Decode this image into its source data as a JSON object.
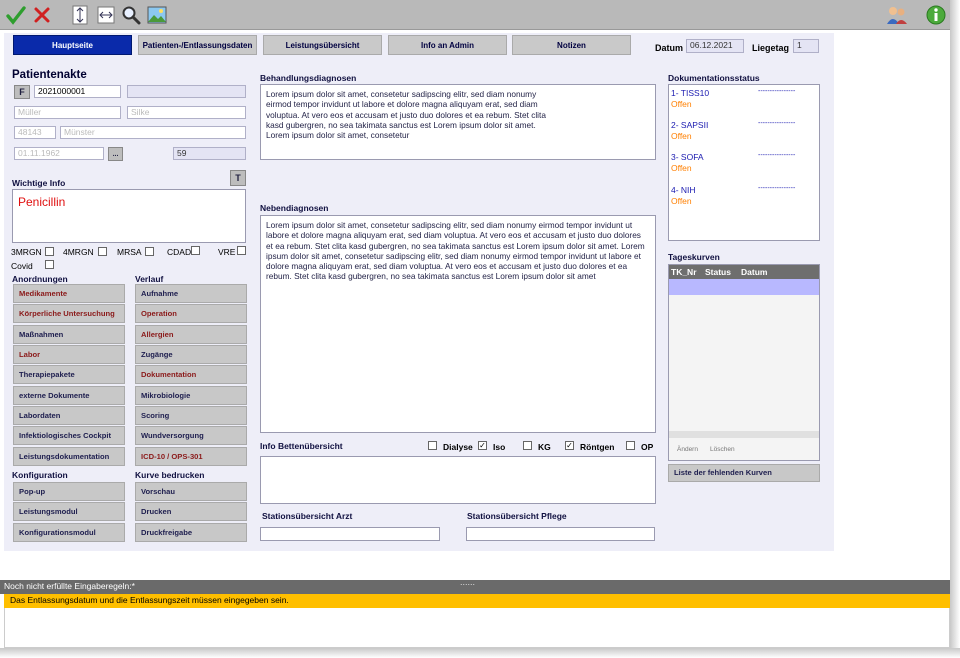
{
  "colors": {
    "accent": "#0a2aaa",
    "toolbar": "#b9b9b9",
    "form_bg": "#eeeef8",
    "warning": "#ffbf00",
    "red": "#8b1a1a",
    "offen": "#ff7f00"
  },
  "toolbar": {
    "icons": [
      "checkmark-icon",
      "cancel-x-icon",
      "expand-vertical-icon",
      "expand-horizontal-icon",
      "magnifier-icon",
      "image-icon",
      "users-icon",
      "info-icon"
    ]
  },
  "tabs": [
    {
      "label": "Hauptseite"
    },
    {
      "label": "Patienten-/Entlassungsdaten"
    },
    {
      "label": "Leistungsübersicht"
    },
    {
      "label": "Info an Admin"
    },
    {
      "label": "Notizen"
    }
  ],
  "header": {
    "datum_label": "Datum",
    "datum_value": "06.12.2021",
    "liegetag_label": "Liegetag",
    "liegetag_value": "1"
  },
  "patient": {
    "title": "Patientenakte",
    "f_button": "F",
    "id": "2021000001",
    "lastname": "Müller",
    "firstname": "Silke",
    "zip": "48143",
    "city": "Münster",
    "birthdate": "01.11.1962",
    "dots_button": "...",
    "age": "59"
  },
  "wichtig": {
    "label": "Wichtige Info",
    "t_button": "T",
    "text": "Penicillin"
  },
  "flags": [
    {
      "label": "3MRGN",
      "checked": false
    },
    {
      "label": "4MRGN",
      "checked": false
    },
    {
      "label": "MRSA",
      "checked": false
    },
    {
      "label": "CDAD",
      "checked": false
    },
    {
      "label": "VRE",
      "checked": false
    },
    {
      "label": "Covid",
      "checked": false
    }
  ],
  "anordnungen": {
    "label": "Anordnungen",
    "items": [
      "Medikamente",
      "Körperliche Untersuchung",
      "Maßnahmen",
      "Labor",
      "Therapiepakete",
      "externe Dokumente",
      "Labordaten",
      "Infektiologisches Cockpit",
      "Leistungsdokumentation"
    ]
  },
  "verlauf": {
    "label": "Verlauf",
    "items": [
      "Aufnahme",
      "Operation",
      "Allergien",
      "Zugänge",
      "Dokumentation",
      "Mikrobiologie",
      "Scoring",
      "Wundversorgung",
      "ICD-10 / OPS-301"
    ]
  },
  "konfiguration": {
    "label": "Konfiguration",
    "items": [
      "Pop-up",
      "Leistungsmodul",
      "Konfigurationsmodul"
    ]
  },
  "kurve": {
    "label": "Kurve bedrucken",
    "items": [
      "Vorschau",
      "Drucken",
      "Druckfreigabe"
    ]
  },
  "behandlung": {
    "label": "Behandlungsdiagnosen",
    "text": "Lorem ipsum dolor sit amet, consetetur sadipscing elitr, sed diam nonumy eirmod tempor invidunt ut labore et dolore magna aliquyam erat, sed diam voluptua. At vero eos et accusam et justo duo dolores et ea rebum. Stet clita kasd gubergren, no sea takimata sanctus est Lorem ipsum dolor sit amet. Lorem ipsum dolor sit amet, consetetur"
  },
  "neben": {
    "label": "Nebendiagnosen",
    "text": "Lorem ipsum dolor sit amet, consetetur sadipscing elitr, sed diam nonumy eirmod tempor invidunt ut labore et dolore magna aliquyam erat, sed diam voluptua. At vero eos et accusam et justo duo dolores et ea rebum. Stet clita kasd gubergren, no sea takimata sanctus est Lorem ipsum dolor sit amet. Lorem ipsum dolor sit amet, consetetur sadipscing elitr, sed diam nonumy eirmod tempor invidunt ut labore et dolore magna aliquyam erat, sed diam voluptua. At vero eos et accusam et justo duo dolores et ea rebum. Stet clita kasd gubergren, no sea takimata sanctus est Lorem ipsum dolor sit amet"
  },
  "betten": {
    "label": "Info Bettenübersicht",
    "options": [
      {
        "label": "Dialyse",
        "checked": false
      },
      {
        "label": "Iso",
        "checked": true
      },
      {
        "label": "KG",
        "checked": false
      },
      {
        "label": "Röntgen",
        "checked": true
      },
      {
        "label": "OP",
        "checked": false
      }
    ]
  },
  "station_arzt": {
    "label": "Stationsübersicht Arzt"
  },
  "station_pflege": {
    "label": "Stationsübersicht Pflege"
  },
  "doku_status": {
    "label": "Dokumentationsstatus",
    "items": [
      {
        "name": "1- TISS10",
        "status": "Offen",
        "dashes": "----------------"
      },
      {
        "name": "2- SAPSII",
        "status": "Offen",
        "dashes": "----------------"
      },
      {
        "name": "3- SOFA",
        "status": "Offen",
        "dashes": "----------------"
      },
      {
        "name": "4- NIH",
        "status": "Offen",
        "dashes": "----------------"
      }
    ]
  },
  "tageskurven": {
    "label": "Tageskurven",
    "columns": [
      "TK_Nr",
      "Status",
      "Datum"
    ],
    "andern": "Ändern",
    "loschen": "Löschen",
    "fehlende_button": "Liste der fehlenden Kurven"
  },
  "footer": {
    "splitter": "......",
    "rules_label": "Noch nicht erfüllte Eingaberegeln:*",
    "message": "Das Entlassungsdatum und die Entlassungszeit müssen eingegeben sein."
  }
}
